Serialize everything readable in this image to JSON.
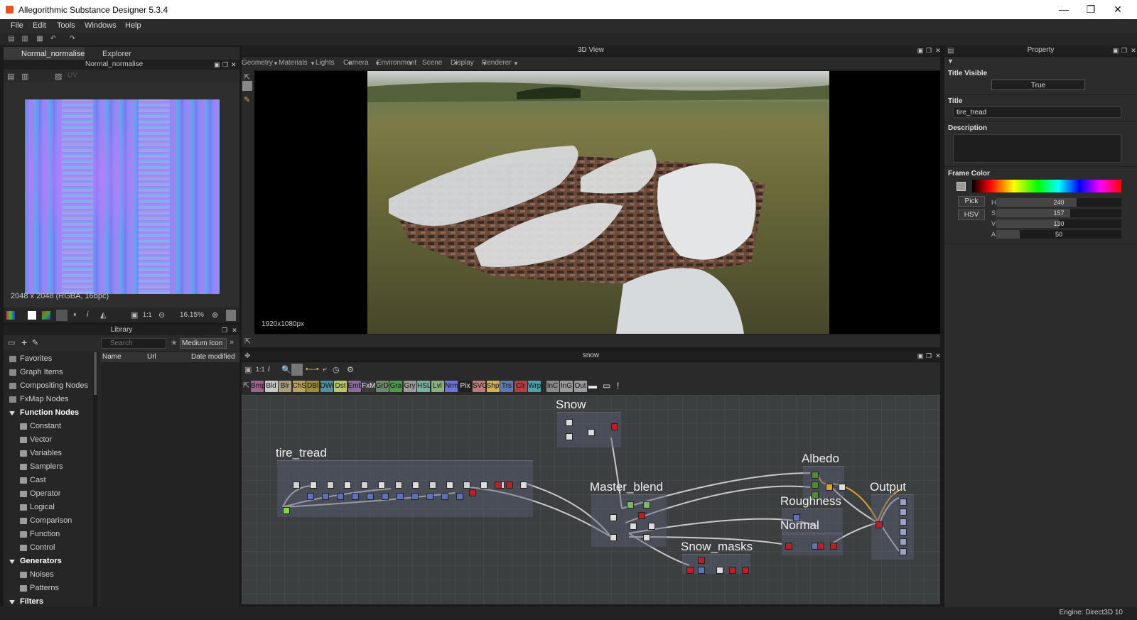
{
  "window": {
    "title": "Allegorithmic Substance Designer 5.3.4",
    "minimize": "—",
    "restore": "❐",
    "close": "✕"
  },
  "menu": [
    "File",
    "Edit",
    "Tools",
    "Windows",
    "Help"
  ],
  "left_tabs": {
    "active": "Normal_normalise",
    "other": "Explorer"
  },
  "viewer2d": {
    "title": "Normal_normalise",
    "uv_label": "UV",
    "info": "2048 x 2048 (RGBA, 16bpc)",
    "zoom": "16.15%",
    "ratio": "1:1"
  },
  "library": {
    "title": "Library",
    "search_placeholder": "Search",
    "view_mode": "Medium Icon",
    "columns": [
      "Name",
      "Url",
      "Date modified"
    ],
    "items": [
      {
        "label": "Favorites",
        "kind": "top"
      },
      {
        "label": "Graph Items",
        "kind": "top"
      },
      {
        "label": "Compositing Nodes",
        "kind": "top"
      },
      {
        "label": "FxMap Nodes",
        "kind": "top"
      },
      {
        "label": "Function Nodes",
        "kind": "cat"
      },
      {
        "label": "Constant",
        "kind": "sub"
      },
      {
        "label": "Vector",
        "kind": "sub"
      },
      {
        "label": "Variables",
        "kind": "sub"
      },
      {
        "label": "Samplers",
        "kind": "sub"
      },
      {
        "label": "Cast",
        "kind": "sub"
      },
      {
        "label": "Operator",
        "kind": "sub"
      },
      {
        "label": "Logical",
        "kind": "sub"
      },
      {
        "label": "Comparison",
        "kind": "sub"
      },
      {
        "label": "Function",
        "kind": "sub"
      },
      {
        "label": "Control",
        "kind": "sub"
      },
      {
        "label": "Generators",
        "kind": "cat"
      },
      {
        "label": "Noises",
        "kind": "sub"
      },
      {
        "label": "Patterns",
        "kind": "sub"
      },
      {
        "label": "Filters",
        "kind": "cat"
      }
    ]
  },
  "view3d": {
    "title": "3D View",
    "menus": [
      "Geometry",
      "Materials",
      "Lights",
      "Camera",
      "Environment",
      "Scene",
      "Display",
      "Renderer"
    ],
    "resolution": "1920x1080px"
  },
  "graph": {
    "title": "snow",
    "ratio": "1:1",
    "atoms": [
      {
        "label": "Bmp",
        "color": "#a0618a"
      },
      {
        "label": "Bld",
        "color": "#c9c9c9"
      },
      {
        "label": "Blr",
        "color": "#a79f7e"
      },
      {
        "label": "ChS",
        "color": "#b8a35a"
      },
      {
        "label": "DBl",
        "color": "#a08a3a"
      },
      {
        "label": "DWr",
        "color": "#4f8fa0"
      },
      {
        "label": "Dst",
        "color": "#b8c86a"
      },
      {
        "label": "Emb",
        "color": "#8a6aa0"
      },
      {
        "label": "FxM",
        "color": "#3c3c3c"
      },
      {
        "label": "GrD",
        "color": "#6a8a6a"
      },
      {
        "label": "Gra",
        "color": "#4a9a4a"
      },
      {
        "label": "Gry",
        "color": "#9a9a9a"
      },
      {
        "label": "HSL",
        "color": "#7ab0a0"
      },
      {
        "label": "Lvl",
        "color": "#8ab080"
      },
      {
        "label": "Nrm",
        "color": "#7070e0"
      },
      {
        "label": "Pix",
        "color": "#202020"
      },
      {
        "label": "SVG",
        "color": "#c07a7a"
      },
      {
        "label": "Shp",
        "color": "#d0b050"
      },
      {
        "label": "Trs",
        "color": "#5a7ab0"
      },
      {
        "label": "Clr",
        "color": "#b04040"
      },
      {
        "label": "Wrp",
        "color": "#50a0b0"
      },
      {
        "label": "InC",
        "color": "#8a8a8a"
      },
      {
        "label": "InG",
        "color": "#9a9a9a"
      },
      {
        "label": "Out",
        "color": "#9a9aa0"
      }
    ],
    "frames": [
      "Snow",
      "tire_tread",
      "Master_blend",
      "Snow_masks",
      "Albedo",
      "Roughness",
      "Normal",
      "Output"
    ]
  },
  "property": {
    "title": "Property",
    "title_visible_label": "Title Visible",
    "title_visible_value": "True",
    "title_label": "Title",
    "title_value": "tire_tread",
    "description_label": "Description",
    "frame_color_label": "Frame Color",
    "pick_label": "Pick",
    "hsv_label": "HSV",
    "h_label": "H",
    "h_value": "240",
    "h_fraction": 0.64,
    "s_label": "S",
    "s_value": "157",
    "s_fraction": 0.59,
    "v_label": "V",
    "v_value": "130",
    "v_fraction": 0.5,
    "a_label": "A",
    "a_value": "50",
    "a_fraction": 0.19
  },
  "status": {
    "engine": "Engine: Direct3D 10"
  }
}
